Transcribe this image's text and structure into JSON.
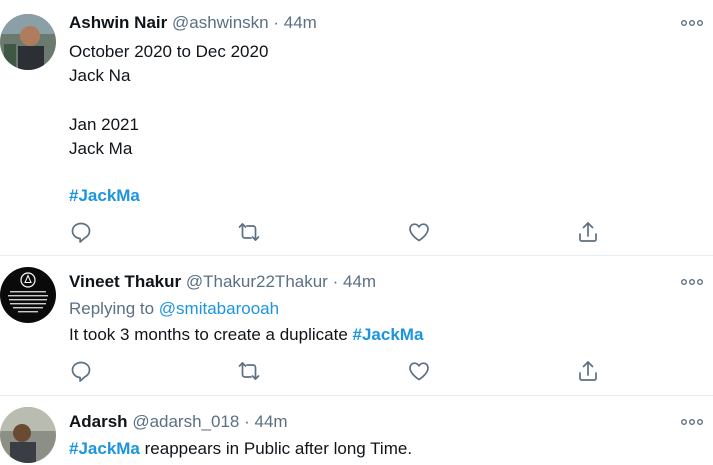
{
  "tweets": [
    {
      "name": "Ashwin Nair",
      "handle": "@ashwinskn",
      "dot": "·",
      "time": "44m",
      "lines": [
        "October 2020 to Dec 2020",
        "Jack Na",
        "Jan 2021",
        "Jack Ma"
      ],
      "hashtag": "#JackMa"
    },
    {
      "name": "Vineet Thakur",
      "handle": "@Thakur22Thakur",
      "dot": "·",
      "time": "44m",
      "replying_label": "Replying to",
      "replying_handle": "@smitabarooah",
      "text": "It took 3 months to create a duplicate",
      "hashtag": "#JackMa",
      "avatar_text": "ATHARVA PATHAK THE COURAGE TO TELL PEOPLE THAT YOU'RE NOT AFRAID OF THEIR OBSERVATION"
    },
    {
      "name": "Adarsh",
      "handle": "@adarsh_018",
      "dot": "·",
      "time": "44m",
      "hashtag": "#JackMa",
      "text": "reappears in Public after long Time."
    }
  ],
  "icons": {
    "reply": "reply-icon",
    "retweet": "retweet-icon",
    "like": "heart-icon",
    "share": "share-icon",
    "more": "more-icon"
  },
  "colors": {
    "link": "#1b95e0",
    "secondary": "#5b7083",
    "icon": "#5b7083",
    "divider": "#e6ecf0"
  }
}
